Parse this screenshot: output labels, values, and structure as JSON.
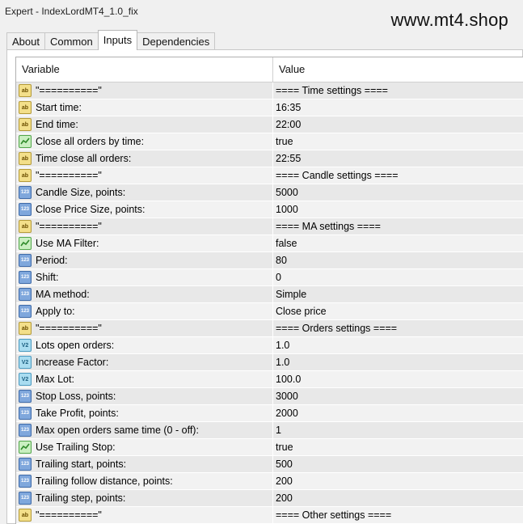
{
  "window": {
    "title": "Expert - IndexLordMT4_1.0_fix",
    "watermark": "www.mt4.shop"
  },
  "tabs": [
    {
      "label": "About"
    },
    {
      "label": "Common"
    },
    {
      "label": "Inputs",
      "active": true
    },
    {
      "label": "Dependencies"
    }
  ],
  "table": {
    "headers": {
      "variable": "Variable",
      "value": "Value"
    },
    "rows": [
      {
        "icon": "ab",
        "variable": "\"==========\"",
        "value": "==== Time settings ===="
      },
      {
        "icon": "ab",
        "variable": "Start time:",
        "value": "16:35"
      },
      {
        "icon": "ab",
        "variable": "End time:",
        "value": "22:00"
      },
      {
        "icon": "bool",
        "variable": "Close all orders by time:",
        "value": "true"
      },
      {
        "icon": "ab",
        "variable": "Time close all orders:",
        "value": "22:55"
      },
      {
        "icon": "ab",
        "variable": "\"==========\"",
        "value": "==== Candle settings ===="
      },
      {
        "icon": "123",
        "variable": "Candle Size, points:",
        "value": "5000"
      },
      {
        "icon": "123",
        "variable": "Close Price Size, points:",
        "value": "1000"
      },
      {
        "icon": "ab",
        "variable": "\"==========\"",
        "value": "==== MA settings ===="
      },
      {
        "icon": "bool",
        "variable": "Use MA Filter:",
        "value": "false"
      },
      {
        "icon": "123",
        "variable": "Period:",
        "value": "80"
      },
      {
        "icon": "123",
        "variable": "Shift:",
        "value": "0"
      },
      {
        "icon": "123",
        "variable": "MA method:",
        "value": "Simple"
      },
      {
        "icon": "123",
        "variable": "Apply to:",
        "value": "Close price"
      },
      {
        "icon": "ab",
        "variable": "\"==========\"",
        "value": "==== Orders settings ===="
      },
      {
        "icon": "v2",
        "variable": "Lots open orders:",
        "value": "1.0"
      },
      {
        "icon": "v2",
        "variable": "Increase Factor:",
        "value": "1.0"
      },
      {
        "icon": "v2",
        "variable": "Max Lot:",
        "value": "100.0"
      },
      {
        "icon": "123",
        "variable": "Stop Loss, points:",
        "value": "3000"
      },
      {
        "icon": "123",
        "variable": "Take Profit, points:",
        "value": "2000"
      },
      {
        "icon": "123",
        "variable": "Max open orders same time (0 - off):",
        "value": "1"
      },
      {
        "icon": "bool",
        "variable": "Use Trailing Stop:",
        "value": "true"
      },
      {
        "icon": "123",
        "variable": "Trailing start, points:",
        "value": "500"
      },
      {
        "icon": "123",
        "variable": "Trailing follow distance, points:",
        "value": "200"
      },
      {
        "icon": "123",
        "variable": "Trailing step, points:",
        "value": "200"
      },
      {
        "icon": "ab",
        "variable": "\"==========\"",
        "value": "==== Other settings ===="
      }
    ]
  }
}
